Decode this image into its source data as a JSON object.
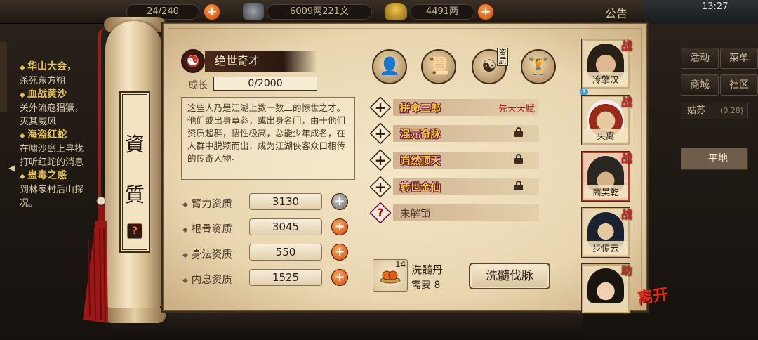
{
  "topbar": {
    "res1": "24/240",
    "res2": "6009两221文",
    "res3": "4491两",
    "notice": "公告",
    "time": "13:27"
  },
  "quests": [
    {
      "title": "华山大会，",
      "desc": "杀死东方朔"
    },
    {
      "title": "血战黄沙",
      "desc": "关外流寇猖獗，\n灭其威风"
    },
    {
      "title": "海盗红蛇",
      "desc": "在啸沙岛上寻找\n打听红蛇的消息"
    },
    {
      "title": "蛊毒之惑",
      "desc": "到林家村后山探\n况。"
    }
  ],
  "right_menu": {
    "b1": "活动",
    "b2": "菜单",
    "b3": "商城",
    "b4": "社区",
    "location": "姑苏",
    "coord": "(0,28)",
    "flat": "平地"
  },
  "scroll": {
    "c1": "資",
    "c2": "質",
    "help": "?"
  },
  "talent_header": {
    "title": "绝世奇才",
    "growth_label": "成长",
    "growth_value": "0/2000",
    "description": "这些人乃是江湖上数一数二的惊世之才。他们或出身草莽，或出身名门，由于他们资质超群，悟性极高，总能少年成名，在人群中脱颖而出，成为江湖侠客众口相传的传奇人物。"
  },
  "stats": [
    {
      "label": "臂力资质",
      "value": "3130",
      "btn": "grey"
    },
    {
      "label": "根骨资质",
      "value": "3045",
      "btn": "orange"
    },
    {
      "label": "身法资质",
      "value": "550",
      "btn": "orange"
    },
    {
      "label": "内息资质",
      "value": "1525",
      "btn": "orange"
    }
  ],
  "badge_zizhi": "资质",
  "talents": [
    {
      "name": "拼命三郎",
      "tag": "先天天赋",
      "locked": false
    },
    {
      "name": "混元奇脉",
      "tag": "",
      "locked": true
    },
    {
      "name": "岿然顶天",
      "tag": "",
      "locked": true
    },
    {
      "name": "转世金仙",
      "tag": "",
      "locked": true
    },
    {
      "name": "未解锁",
      "tag": "",
      "locked": false
    }
  ],
  "item": {
    "qty": "14",
    "name": "洗髓丹",
    "need": "需要 8"
  },
  "wash_button": "洗髓伐脉",
  "roster": [
    {
      "name": "冷擎汉",
      "flag": "战"
    },
    {
      "name": "央离",
      "flag": "战"
    },
    {
      "name": "商昊乾",
      "flag": "战"
    },
    {
      "name": "步惊云",
      "flag": "战"
    },
    {
      "name": "",
      "flag": "助"
    }
  ],
  "leave": "离开",
  "colors": {
    "accent": "#d04a0a",
    "talent_name": "#f0d030",
    "talent_tag": "#b01818"
  }
}
